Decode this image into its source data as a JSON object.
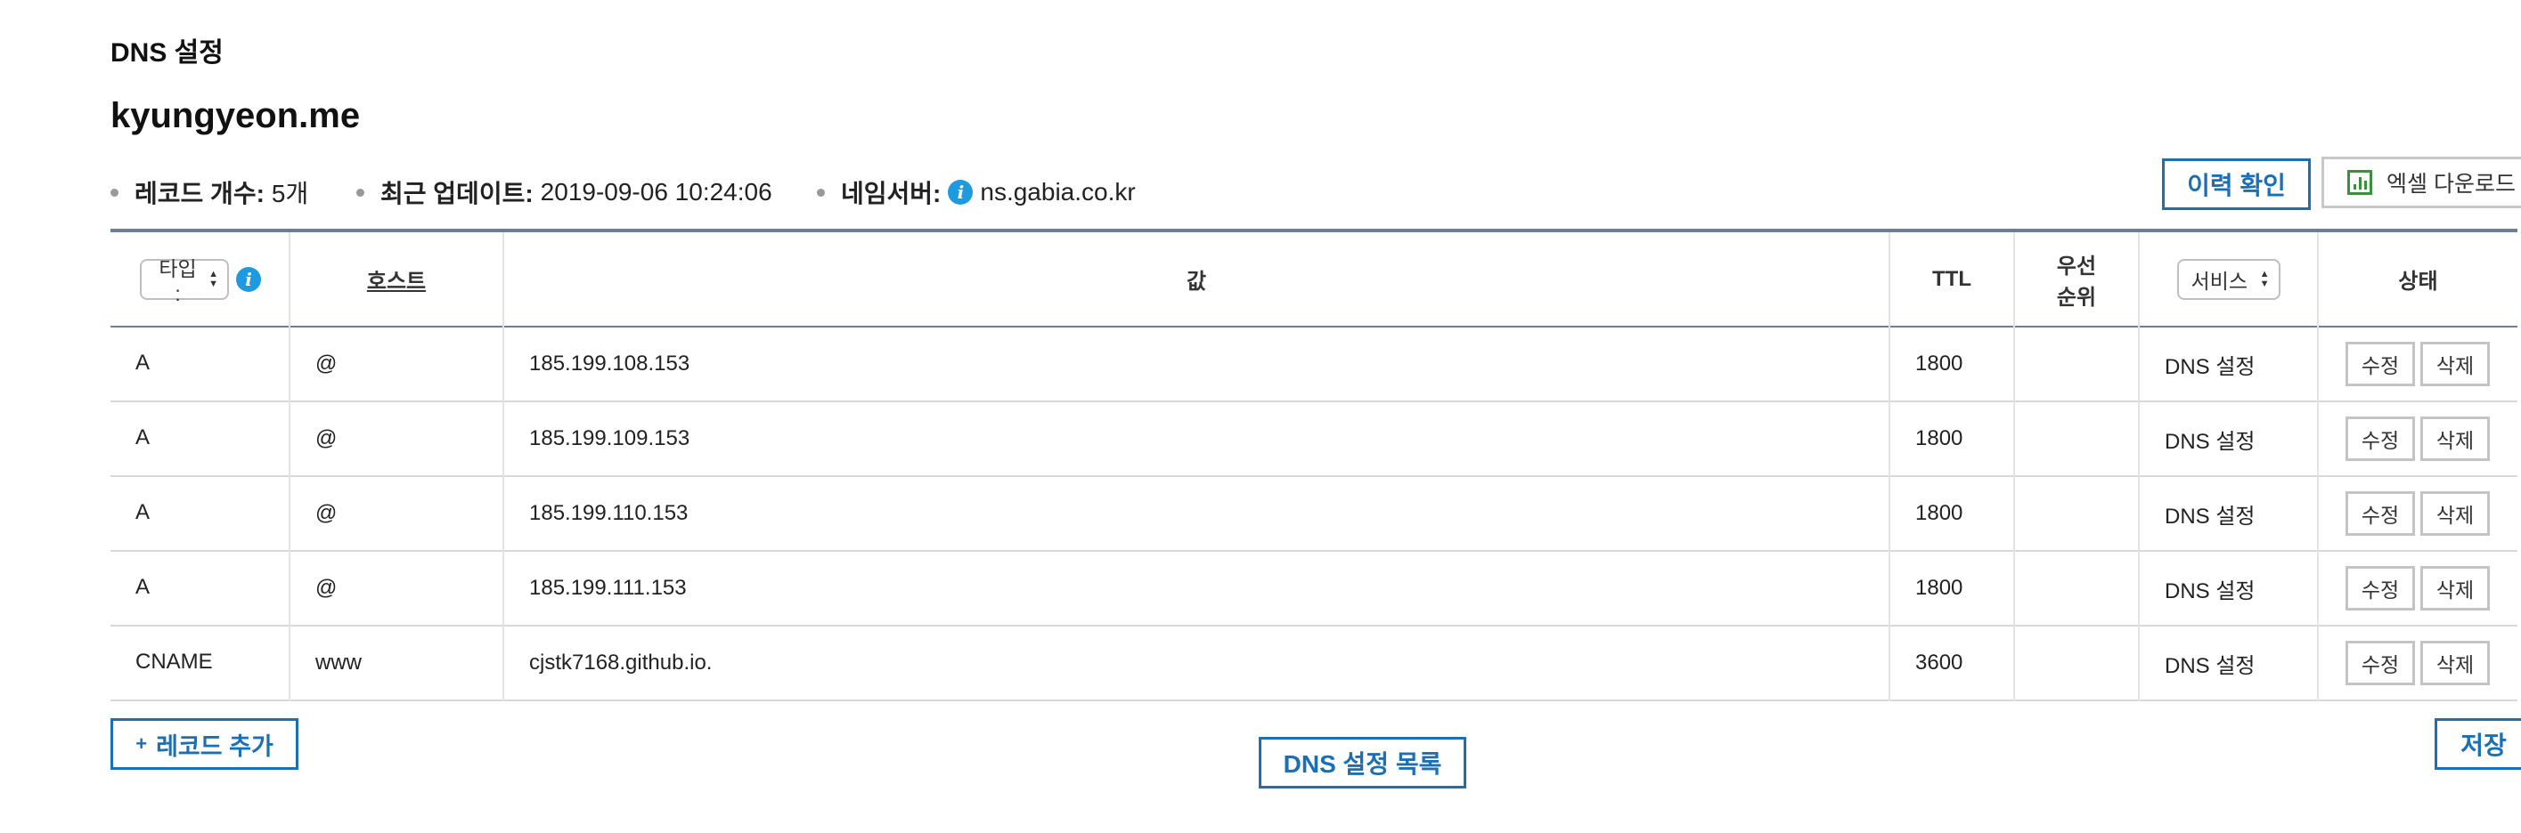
{
  "page": {
    "section_title": "DNS 설정",
    "domain": "kyungyeon.me"
  },
  "summary": {
    "record_count_label": "레코드 개수:",
    "record_count_value": "5개",
    "updated_label": "최근 업데이트:",
    "updated_value": "2019-09-06 10:24:06",
    "nameserver_label": "네임서버:",
    "nameserver_value": "ns.gabia.co.kr"
  },
  "actions": {
    "history_button": "이력 확인",
    "excel_button": "엑셀 다운로드"
  },
  "table": {
    "headers": {
      "type_select": "타입 :",
      "host": "호스트",
      "value": "값",
      "ttl": "TTL",
      "priority_line1": "우선",
      "priority_line2": "순위",
      "service_select": "서비스",
      "status": "상태"
    },
    "rows": [
      {
        "type": "A",
        "host": "@",
        "value": "185.199.108.153",
        "ttl": "1800",
        "priority": "",
        "service": "DNS 설정",
        "edit": "수정",
        "delete": "삭제"
      },
      {
        "type": "A",
        "host": "@",
        "value": "185.199.109.153",
        "ttl": "1800",
        "priority": "",
        "service": "DNS 설정",
        "edit": "수정",
        "delete": "삭제"
      },
      {
        "type": "A",
        "host": "@",
        "value": "185.199.110.153",
        "ttl": "1800",
        "priority": "",
        "service": "DNS 설정",
        "edit": "수정",
        "delete": "삭제"
      },
      {
        "type": "A",
        "host": "@",
        "value": "185.199.111.153",
        "ttl": "1800",
        "priority": "",
        "service": "DNS 설정",
        "edit": "수정",
        "delete": "삭제"
      },
      {
        "type": "CNAME",
        "host": "www",
        "value": "cjstk7168.github.io.",
        "ttl": "3600",
        "priority": "",
        "service": "DNS 설정",
        "edit": "수정",
        "delete": "삭제"
      }
    ]
  },
  "footer": {
    "add_record": "레코드 추가",
    "add_icon": "+",
    "dns_list": "DNS 설정 목록",
    "save": "저장"
  },
  "icons": {
    "info": "info-icon",
    "excel": "excel-chart-icon",
    "select_arrows": "updown-arrows-icon"
  },
  "colors": {
    "accent_blue": "#1a6fb5",
    "info_blue": "#1e9be0",
    "excel_green": "#3c8f3c",
    "header_border": "#6d7f95"
  }
}
